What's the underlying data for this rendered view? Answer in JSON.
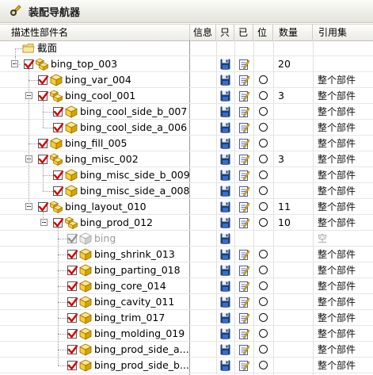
{
  "title": "装配导航器",
  "columns": {
    "name": "描述性部件名",
    "info": "信息",
    "readonly": "只",
    "modified": "已",
    "position": "位",
    "count": "数量",
    "refset": "引用集"
  },
  "rows": [
    {
      "label": "截面",
      "count": "",
      "ref": ""
    },
    {
      "label": "bing_top_003",
      "count": "20",
      "ref": ""
    },
    {
      "label": "bing_var_004",
      "count": "",
      "ref": "整个部件"
    },
    {
      "label": "bing_cool_001",
      "count": "3",
      "ref": "整个部件"
    },
    {
      "label": "bing_cool_side_b_007",
      "count": "",
      "ref": "整个部件"
    },
    {
      "label": "bing_cool_side_a_006",
      "count": "",
      "ref": "整个部件"
    },
    {
      "label": "bing_fill_005",
      "count": "",
      "ref": "整个部件"
    },
    {
      "label": "bing_misc_002",
      "count": "3",
      "ref": "整个部件"
    },
    {
      "label": "bing_misc_side_b_009",
      "count": "",
      "ref": "整个部件"
    },
    {
      "label": "bing_misc_side_a_008",
      "count": "",
      "ref": "整个部件"
    },
    {
      "label": "bing_layout_010",
      "count": "11",
      "ref": "整个部件"
    },
    {
      "label": "bing_prod_012",
      "count": "10",
      "ref": "整个部件"
    },
    {
      "label": "bing",
      "count": "",
      "ref": "空"
    },
    {
      "label": "bing_shrink_013",
      "count": "",
      "ref": "整个部件"
    },
    {
      "label": "bing_parting_018",
      "count": "",
      "ref": "整个部件"
    },
    {
      "label": "bing_core_014",
      "count": "",
      "ref": "整个部件"
    },
    {
      "label": "bing_cavity_011",
      "count": "",
      "ref": "整个部件"
    },
    {
      "label": "bing_trim_017",
      "count": "",
      "ref": "整个部件"
    },
    {
      "label": "bing_molding_019",
      "count": "",
      "ref": "整个部件"
    },
    {
      "label": "bing_prod_side_a...",
      "count": "",
      "ref": "整个部件"
    },
    {
      "label": "bing_prod_side_b...",
      "count": "",
      "ref": "整个部件"
    }
  ]
}
